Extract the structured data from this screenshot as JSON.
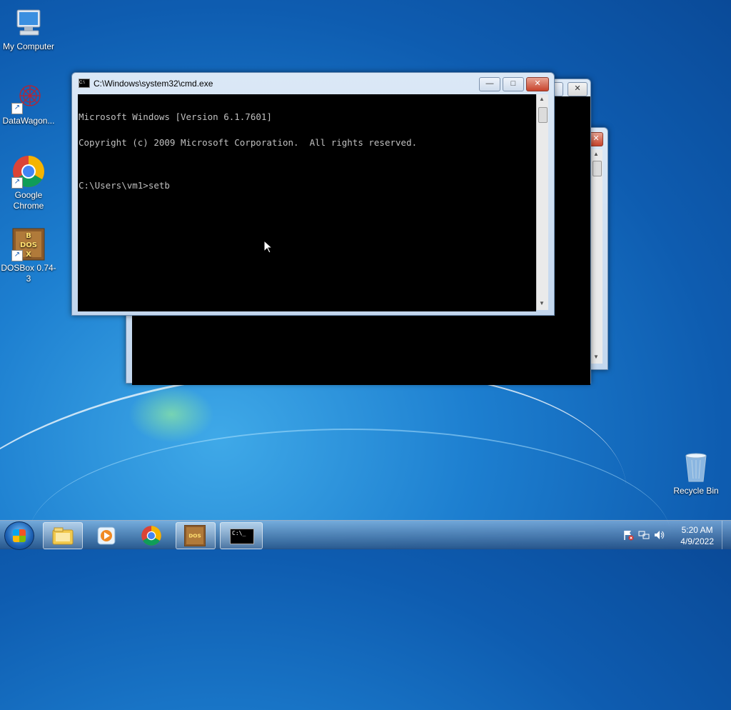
{
  "desktop": {
    "icons": [
      {
        "label": "My Computer"
      },
      {
        "label": "DataWagon..."
      },
      {
        "label": "Google Chrome"
      },
      {
        "label": "DOSBox 0.74-3"
      },
      {
        "label": "Recycle Bin"
      }
    ]
  },
  "cmd_window": {
    "title": "C:\\Windows\\system32\\cmd.exe",
    "icon": "cmd-icon",
    "lines": [
      "Microsoft Windows [Version 6.1.7601]",
      "Copyright (c) 2009 Microsoft Corporation.  All rights reserved.",
      "",
      "C:\\Users\\vm1>setb"
    ],
    "controls": {
      "minimize": "—",
      "maximize": "□",
      "close": "✕"
    }
  },
  "background_windows": {
    "close": "✕",
    "minimize": "—"
  },
  "taskbar": {
    "items": [
      {
        "icon": "windows-explorer-icon"
      },
      {
        "icon": "media-player-icon"
      },
      {
        "icon": "chrome-icon"
      },
      {
        "icon": "dosbox-icon"
      },
      {
        "icon": "cmd-icon",
        "label": "C:\\_"
      }
    ],
    "tray": {
      "time": "5:20 AM",
      "date": "4/9/2022"
    }
  }
}
